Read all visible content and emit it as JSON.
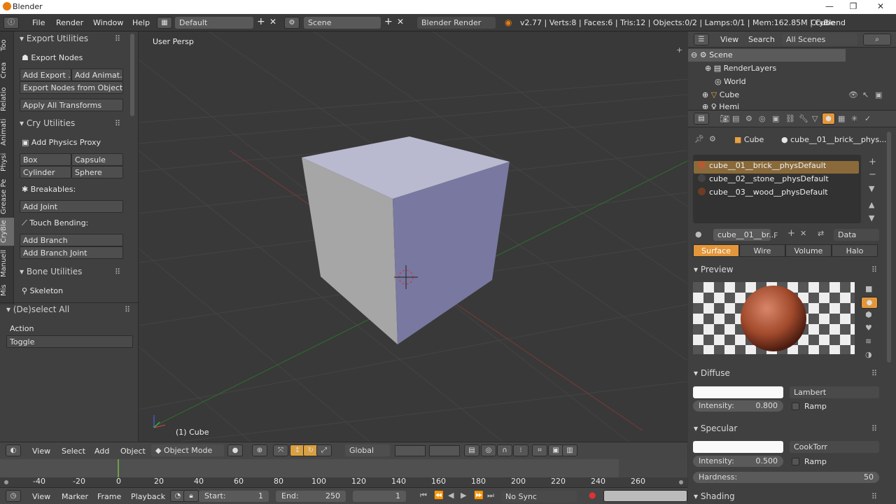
{
  "window": {
    "title": "Blender",
    "min": "—",
    "max": "❐",
    "close": "✕"
  },
  "info": {
    "menus": [
      "File",
      "Render",
      "Window",
      "Help"
    ],
    "layout": "Default",
    "scene": "Scene",
    "engine": "Blender Render",
    "stats": "v2.77 | Verts:8 | Faces:6 | Tris:12 | Objects:0/2 | Lamps:0/1 | Mem:162.85M | Cube",
    "addon": "CryBlend"
  },
  "tabs": [
    "Too",
    "Crea",
    "Relatio",
    "Animati",
    "Physi",
    "Grease Pe",
    "CryBle",
    "Manuell",
    "Mis"
  ],
  "toolshelf": {
    "export_title": "Export Utilities",
    "export_nodes": "Export Nodes",
    "add_export": "Add Export ...",
    "add_anim": "Add Animat...",
    "export_from_objects": "Export Nodes from Objects",
    "apply_transforms": "Apply All Transforms",
    "cry_title": "Cry Utilities",
    "add_physics_proxy": "Add Physics Proxy",
    "box": "Box",
    "capsule": "Capsule",
    "cylinder": "Cylinder",
    "sphere": "Sphere",
    "breakables": "Breakables:",
    "add_joint": "Add Joint",
    "touch_bending": "Touch Bending:",
    "add_branch": "Add Branch",
    "add_branch_joint": "Add Branch Joint",
    "bone_title": "Bone Utilities",
    "skeleton": "Skeleton",
    "deselect_title": "(De)select All",
    "action_label": "Action",
    "action_value": "Toggle"
  },
  "viewport": {
    "view_name": "User Persp",
    "object_label": "(1) Cube"
  },
  "vpheader": {
    "view": "View",
    "select": "Select",
    "add": "Add",
    "object": "Object",
    "mode": "Object Mode",
    "orientation": "Global"
  },
  "timeline": {
    "ticks": [
      "-40",
      "-20",
      "0",
      "20",
      "40",
      "60",
      "80",
      "100",
      "120",
      "140",
      "160",
      "180",
      "200",
      "220",
      "240",
      "260"
    ]
  },
  "tlheader": {
    "view": "View",
    "marker": "Marker",
    "frame": "Frame",
    "playback": "Playback",
    "start_label": "Start:",
    "start_value": "1",
    "end_label": "End:",
    "end_value": "250",
    "current": "1",
    "sync": "No Sync"
  },
  "outliner": {
    "view": "View",
    "search": "Search",
    "filter": "All Scenes",
    "items": [
      "Scene",
      "RenderLayers",
      "World",
      "Cube",
      "Hemi"
    ]
  },
  "props": {
    "object": "Cube",
    "material": "cube__01__brick__phys...",
    "materials": [
      "cube__01__brick__physDefault",
      "cube__02__stone__physDefault",
      "cube__03__wood__physDefault"
    ],
    "mat_field": "cube__01__br...",
    "f_label": "F",
    "data": "Data",
    "tabs": [
      "Surface",
      "Wire",
      "Volume",
      "Halo"
    ],
    "preview": "Preview",
    "diffuse": "Diffuse",
    "diffuse_shader": "Lambert",
    "diffuse_intensity_label": "Intensity:",
    "diffuse_intensity": "0.800",
    "ramp": "Ramp",
    "specular": "Specular",
    "specular_shader": "CookTorr",
    "spec_intensity_label": "Intensity:",
    "spec_intensity": "0.500",
    "hardness_label": "Hardness:",
    "hardness": "50",
    "shading": "Shading"
  },
  "colors": {
    "accent": "#e4963a",
    "panel": "#404040",
    "viewport": "#393939"
  }
}
